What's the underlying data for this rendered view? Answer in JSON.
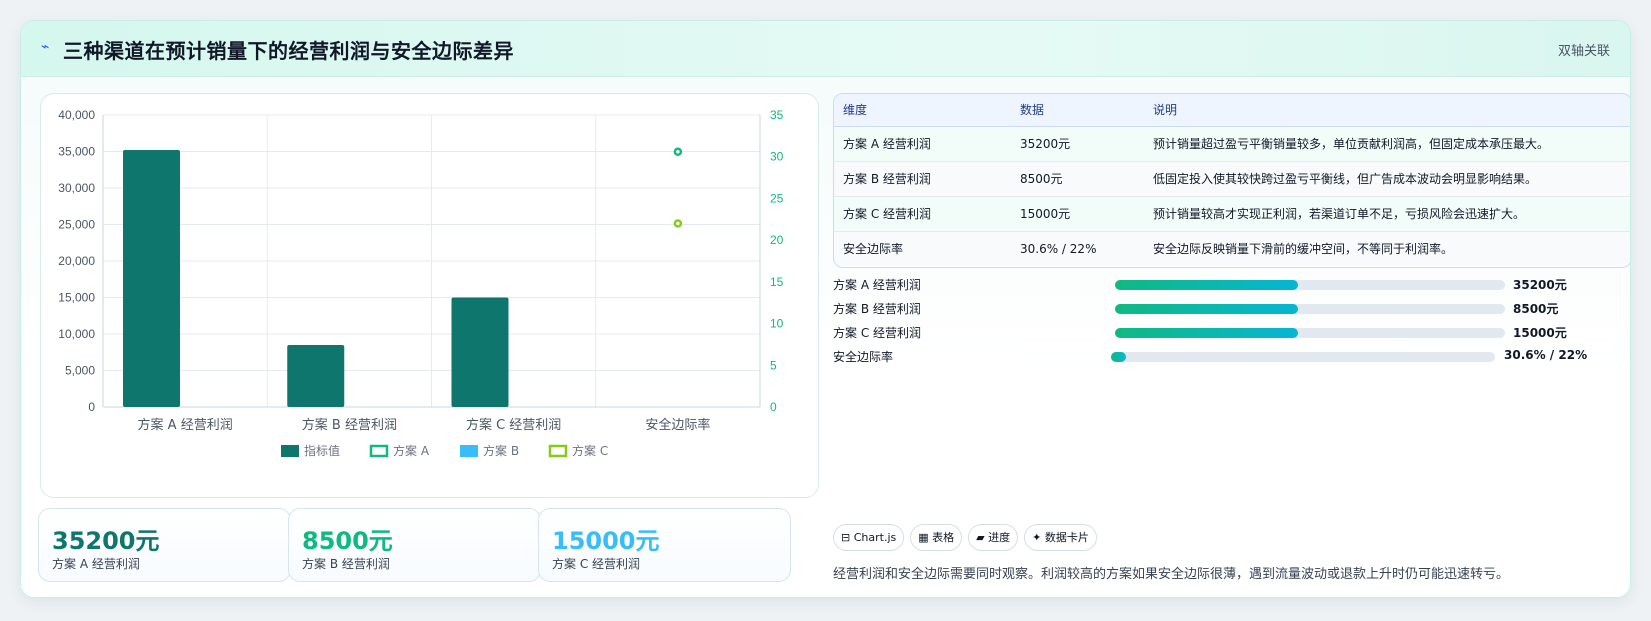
{
  "header": {
    "icon": "⌁",
    "title": "三种渠道在预计销量下的经营利润与安全边际差异",
    "badge": "双轴关联"
  },
  "chart_data": {
    "type": "bar",
    "categories": [
      "方案 A 经营利润",
      "方案 B 经营利润",
      "方案 C 经营利润",
      "安全边际率"
    ],
    "series": [
      {
        "name": "指标值",
        "type": "bar",
        "axis": "left",
        "color": "#0f766e",
        "values": [
          35200,
          8500,
          15000,
          null
        ]
      },
      {
        "name": "方案 A",
        "type": "scatter",
        "axis": "right",
        "color": "#10b981",
        "values": [
          null,
          null,
          null,
          30.6
        ]
      },
      {
        "name": "方案 B",
        "type": "scatter",
        "axis": "right",
        "color": "#38bdf8",
        "values": [
          null,
          null,
          null,
          null
        ]
      },
      {
        "name": "方案 C",
        "type": "scatter",
        "axis": "right",
        "color": "#84cc16",
        "values": [
          null,
          null,
          null,
          22
        ]
      }
    ],
    "ylim": [
      0,
      40000
    ],
    "y_ticks": [
      "40,000",
      "35,000",
      "30,000",
      "25,000",
      "20,000",
      "15,000",
      "10,000",
      "5,000",
      "0"
    ],
    "y2lim": [
      0,
      35
    ],
    "y2_ticks": [
      "35",
      "30",
      "25",
      "20",
      "15",
      "10",
      "5",
      "0"
    ],
    "grid": true,
    "legend_position": "bottom"
  },
  "kpis": [
    {
      "value": "35200元",
      "label": "方案 A 经营利润",
      "color": "#0f766e"
    },
    {
      "value": "8500元",
      "label": "方案 B 经营利润",
      "color": "#10b981"
    },
    {
      "value": "15000元",
      "label": "方案 C 经营利润",
      "color": "#38bdf8"
    }
  ],
  "table": {
    "headers": [
      "维度",
      "数据",
      "说明"
    ],
    "rows": [
      {
        "dim": "方案 A 经营利润",
        "data": "35200元",
        "desc": "预计销量超过盈亏平衡销量较多，单位贡献利润高，但固定成本承压最大。"
      },
      {
        "dim": "方案 B 经营利润",
        "data": "8500元",
        "desc": "低固定投入使其较快跨过盈亏平衡线，但广告成本波动会明显影响结果。"
      },
      {
        "dim": "方案 C 经营利润",
        "data": "15000元",
        "desc": "预计销量较高才实现正利润，若渠道订单不足，亏损风险会迅速扩大。"
      },
      {
        "dim": "安全边际率",
        "data": "30.6% / 22%",
        "desc": "安全边际反映销量下滑前的缓冲空间，不等同于利润率。"
      }
    ]
  },
  "progress": [
    {
      "label": "方案 A 经营利润",
      "value": "35200元",
      "fraction": 0.47
    },
    {
      "label": "方案 B 经营利润",
      "value": "8500元",
      "fraction": 0.47
    },
    {
      "label": "方案 C 经营利润",
      "value": "15000元",
      "fraction": 0.47
    },
    {
      "label": "安全边际率",
      "value": "30.6% / 22%",
      "fraction": 0.04
    }
  ],
  "chips": [
    {
      "icon": "⊟",
      "label": "Chart.js"
    },
    {
      "icon": "▦",
      "label": "表格"
    },
    {
      "icon": "▰",
      "label": "进度"
    },
    {
      "icon": "✦",
      "label": "数据卡片"
    }
  ],
  "note": "经营利润和安全边际需要同时观察。利润较高的方案如果安全边际很薄，遇到流量波动或退款上升时仍可能迅速转亏。"
}
